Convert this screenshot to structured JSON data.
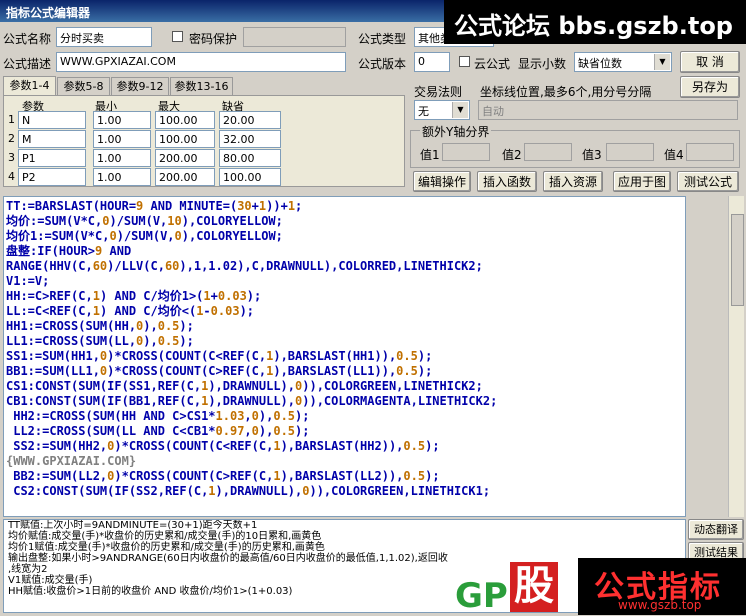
{
  "window": {
    "title": "指标公式编辑器"
  },
  "form": {
    "name_label": "公式名称",
    "name_value": "分时买卖",
    "password_label": "密码保护",
    "desc_label": "公式描述",
    "desc_value": "WWW.GPXIAZAI.COM",
    "type_label": "公式类型",
    "type_value": "其他类",
    "version_label": "公式版本",
    "version_value": "0",
    "cloud_label": "云公式",
    "decimals_label": "显示小数",
    "decimals_value": "缺省位数",
    "cancel_button": "取 消",
    "saveas_button": "另存为",
    "trade_rule_label": "交易法则",
    "trade_rule_value": "无",
    "axis_pos_label": "坐标线位置,最多6个,用分号分隔",
    "axis_pos_value": "自动",
    "extra_y_label": "额外Y轴分界",
    "val_labels": [
      "值1",
      "值2",
      "值3",
      "值4"
    ]
  },
  "tabs": [
    "参数1-4",
    "参数5-8",
    "参数9-12",
    "参数13-16"
  ],
  "params": {
    "headers": [
      "参数",
      "最小",
      "最大",
      "缺省"
    ],
    "rows": [
      {
        "idx": "1",
        "name": "N",
        "min": "1.00",
        "max": "100.00",
        "def": "20.00"
      },
      {
        "idx": "2",
        "name": "M",
        "min": "1.00",
        "max": "100.00",
        "def": "32.00"
      },
      {
        "idx": "3",
        "name": "P1",
        "min": "1.00",
        "max": "200.00",
        "def": "80.00"
      },
      {
        "idx": "4",
        "name": "P2",
        "min": "1.00",
        "max": "200.00",
        "def": "100.00"
      }
    ]
  },
  "actions": [
    "编辑操作",
    "插入函数",
    "插入资源",
    "应用于图",
    "测试公式"
  ],
  "side_buttons": [
    "动态翻译",
    "测试结果"
  ],
  "code_lines": [
    [
      [
        "TT:=BARSLAST(HOUR=",
        "#0000aa"
      ],
      [
        "9",
        "#c07000"
      ],
      [
        " AND MINUTE=(",
        "#0000aa"
      ],
      [
        "30",
        "#c07000"
      ],
      [
        "+",
        "#0000aa"
      ],
      [
        "1",
        "#c07000"
      ],
      [
        "))+",
        "#0000aa"
      ],
      [
        "1",
        "#c07000"
      ],
      [
        ";",
        "#0000aa"
      ]
    ],
    [
      [
        "均价:=SUM(V*C,",
        "#0000aa"
      ],
      [
        "0",
        "#c07000"
      ],
      [
        ")/SUM(V,",
        "#0000aa"
      ],
      [
        "10",
        "#c07000"
      ],
      [
        "),COLORYELLOW;",
        "#0000aa"
      ]
    ],
    [
      [
        "均价1:=SUM(V*C,",
        "#0000aa"
      ],
      [
        "0",
        "#c07000"
      ],
      [
        ")/SUM(V,",
        "#0000aa"
      ],
      [
        "0",
        "#c07000"
      ],
      [
        "),COLORYELLOW;",
        "#0000aa"
      ]
    ],
    [
      [
        "盘整:IF(HOUR>",
        "#0000aa"
      ],
      [
        "9",
        "#c07000"
      ],
      [
        " AND",
        "#0000aa"
      ]
    ],
    [
      [
        "RANGE(HHV(C,",
        "#0000aa"
      ],
      [
        "60",
        "#c07000"
      ],
      [
        ")/LLV(C,",
        "#0000aa"
      ],
      [
        "60",
        "#c07000"
      ],
      [
        "),1,1.02),C,DRAWNULL),COLORRED,LINETHICK2;",
        "#0000aa"
      ]
    ],
    [
      [
        "V1:=V;",
        "#0000aa"
      ]
    ],
    [
      [
        "HH:=C>REF(C,",
        "#0000aa"
      ],
      [
        "1",
        "#c07000"
      ],
      [
        ") AND C/均价1>(",
        "#0000aa"
      ],
      [
        "1",
        "#c07000"
      ],
      [
        "+",
        "#0000aa"
      ],
      [
        "0.03",
        "#c07000"
      ],
      [
        ");",
        "#0000aa"
      ]
    ],
    [
      [
        "LL:=C<REF(C,",
        "#0000aa"
      ],
      [
        "1",
        "#c07000"
      ],
      [
        ") AND C/均价<(",
        "#0000aa"
      ],
      [
        "1",
        "#c07000"
      ],
      [
        "-",
        "#0000aa"
      ],
      [
        "0.03",
        "#c07000"
      ],
      [
        ");",
        "#0000aa"
      ]
    ],
    [
      [
        "HH1:=CROSS(SUM(HH,",
        "#0000aa"
      ],
      [
        "0",
        "#c07000"
      ],
      [
        "),",
        "#0000aa"
      ],
      [
        "0.5",
        "#c07000"
      ],
      [
        ");",
        "#0000aa"
      ]
    ],
    [
      [
        "LL1:=CROSS(SUM(LL,",
        "#0000aa"
      ],
      [
        "0",
        "#c07000"
      ],
      [
        "),",
        "#0000aa"
      ],
      [
        "0.5",
        "#c07000"
      ],
      [
        ");",
        "#0000aa"
      ]
    ],
    [
      [
        "SS1:=SUM(HH1,",
        "#0000aa"
      ],
      [
        "0",
        "#c07000"
      ],
      [
        ")*CROSS(COUNT(C<REF(C,",
        "#0000aa"
      ],
      [
        "1",
        "#c07000"
      ],
      [
        "),BARSLAST(HH1)),",
        "#0000aa"
      ],
      [
        "0.5",
        "#c07000"
      ],
      [
        ");",
        "#0000aa"
      ]
    ],
    [
      [
        "BB1:=SUM(LL1,",
        "#0000aa"
      ],
      [
        "0",
        "#c07000"
      ],
      [
        ")*CROSS(COUNT(C>REF(C,",
        "#0000aa"
      ],
      [
        "1",
        "#c07000"
      ],
      [
        "),BARSLAST(LL1)),",
        "#0000aa"
      ],
      [
        "0.5",
        "#c07000"
      ],
      [
        ");",
        "#0000aa"
      ]
    ],
    [
      [
        "CS1:CONST(SUM(IF(SS1,REF(C,",
        "#0000aa"
      ],
      [
        "1",
        "#c07000"
      ],
      [
        "),DRAWNULL),",
        "#0000aa"
      ],
      [
        "0",
        "#c07000"
      ],
      [
        ")),COLORGREEN,LINETHICK2;",
        "#0000aa"
      ]
    ],
    [
      [
        "CB1:CONST(SUM(IF(BB1,REF(C,",
        "#0000aa"
      ],
      [
        "1",
        "#c07000"
      ],
      [
        "),DRAWNULL),",
        "#0000aa"
      ],
      [
        "0",
        "#c07000"
      ],
      [
        ")),COLORMAGENTA,LINETHICK2;",
        "#0000aa"
      ]
    ],
    [
      [
        " HH2:=CROSS(SUM(HH AND C>CS1*",
        "#0000aa"
      ],
      [
        "1.03",
        "#c07000"
      ],
      [
        ",",
        "#0000aa"
      ],
      [
        "0",
        "#c07000"
      ],
      [
        "),",
        "#0000aa"
      ],
      [
        "0.5",
        "#c07000"
      ],
      [
        ");",
        "#0000aa"
      ]
    ],
    [
      [
        " LL2:=CROSS(SUM(LL AND C<CB1*",
        "#0000aa"
      ],
      [
        "0.97",
        "#c07000"
      ],
      [
        ",",
        "#0000aa"
      ],
      [
        "0",
        "#c07000"
      ],
      [
        "),",
        "#0000aa"
      ],
      [
        "0.5",
        "#c07000"
      ],
      [
        ");",
        "#0000aa"
      ]
    ],
    [
      [
        " SS2:=SUM(HH2,",
        "#0000aa"
      ],
      [
        "0",
        "#c07000"
      ],
      [
        ")*CROSS(COUNT(C<REF(C,",
        "#0000aa"
      ],
      [
        "1",
        "#c07000"
      ],
      [
        "),BARSLAST(HH2)),",
        "#0000aa"
      ],
      [
        "0.5",
        "#c07000"
      ],
      [
        ");",
        "#0000aa"
      ]
    ],
    [
      [
        "{WWW.GPXIAZAI.COM}",
        "#808080"
      ]
    ],
    [
      [
        " BB2:=SUM(LL2,",
        "#0000aa"
      ],
      [
        "0",
        "#c07000"
      ],
      [
        ")*CROSS(COUNT(C>REF(C,",
        "#0000aa"
      ],
      [
        "1",
        "#c07000"
      ],
      [
        "),BARSLAST(LL2)),",
        "#0000aa"
      ],
      [
        "0.5",
        "#c07000"
      ],
      [
        ");",
        "#0000aa"
      ]
    ],
    [
      [
        " CS2:CONST(SUM(IF(SS2,REF(C,",
        "#0000aa"
      ],
      [
        "1",
        "#c07000"
      ],
      [
        "),DRAWNULL),",
        "#0000aa"
      ],
      [
        "0",
        "#c07000"
      ],
      [
        ")),COLORGREEN,LINETHICK1;",
        "#0000aa"
      ]
    ]
  ],
  "output_lines": [
    "TT赋值:上次小时=9ANDMINUTE=(30+1)距今天数+1",
    "均价赋值:成交量(手)*收盘价的历史累和/成交量(手)的10日累和,画黄色",
    "均价1赋值:成交量(手)*收盘价的历史累和/成交量(手)的历史累和,画黄色",
    "输出盘整:如果小时>9ANDRANGE(60日内收盘价的最高值/60日内收盘价的最低值,1,1.02),返回收",
    ",线宽为2",
    "V1赋值:成交量(手)",
    "HH赋值:收盘价>1日前的收盘价 AND 收盘价/均价1>(1+0.03)"
  ],
  "watermarks": {
    "top": "公式论坛 bbs.gszb.top",
    "bottom_main": "公式指标",
    "bottom_url": "www.gszb.top",
    "logo_left": "GP",
    "logo_char": "股"
  }
}
